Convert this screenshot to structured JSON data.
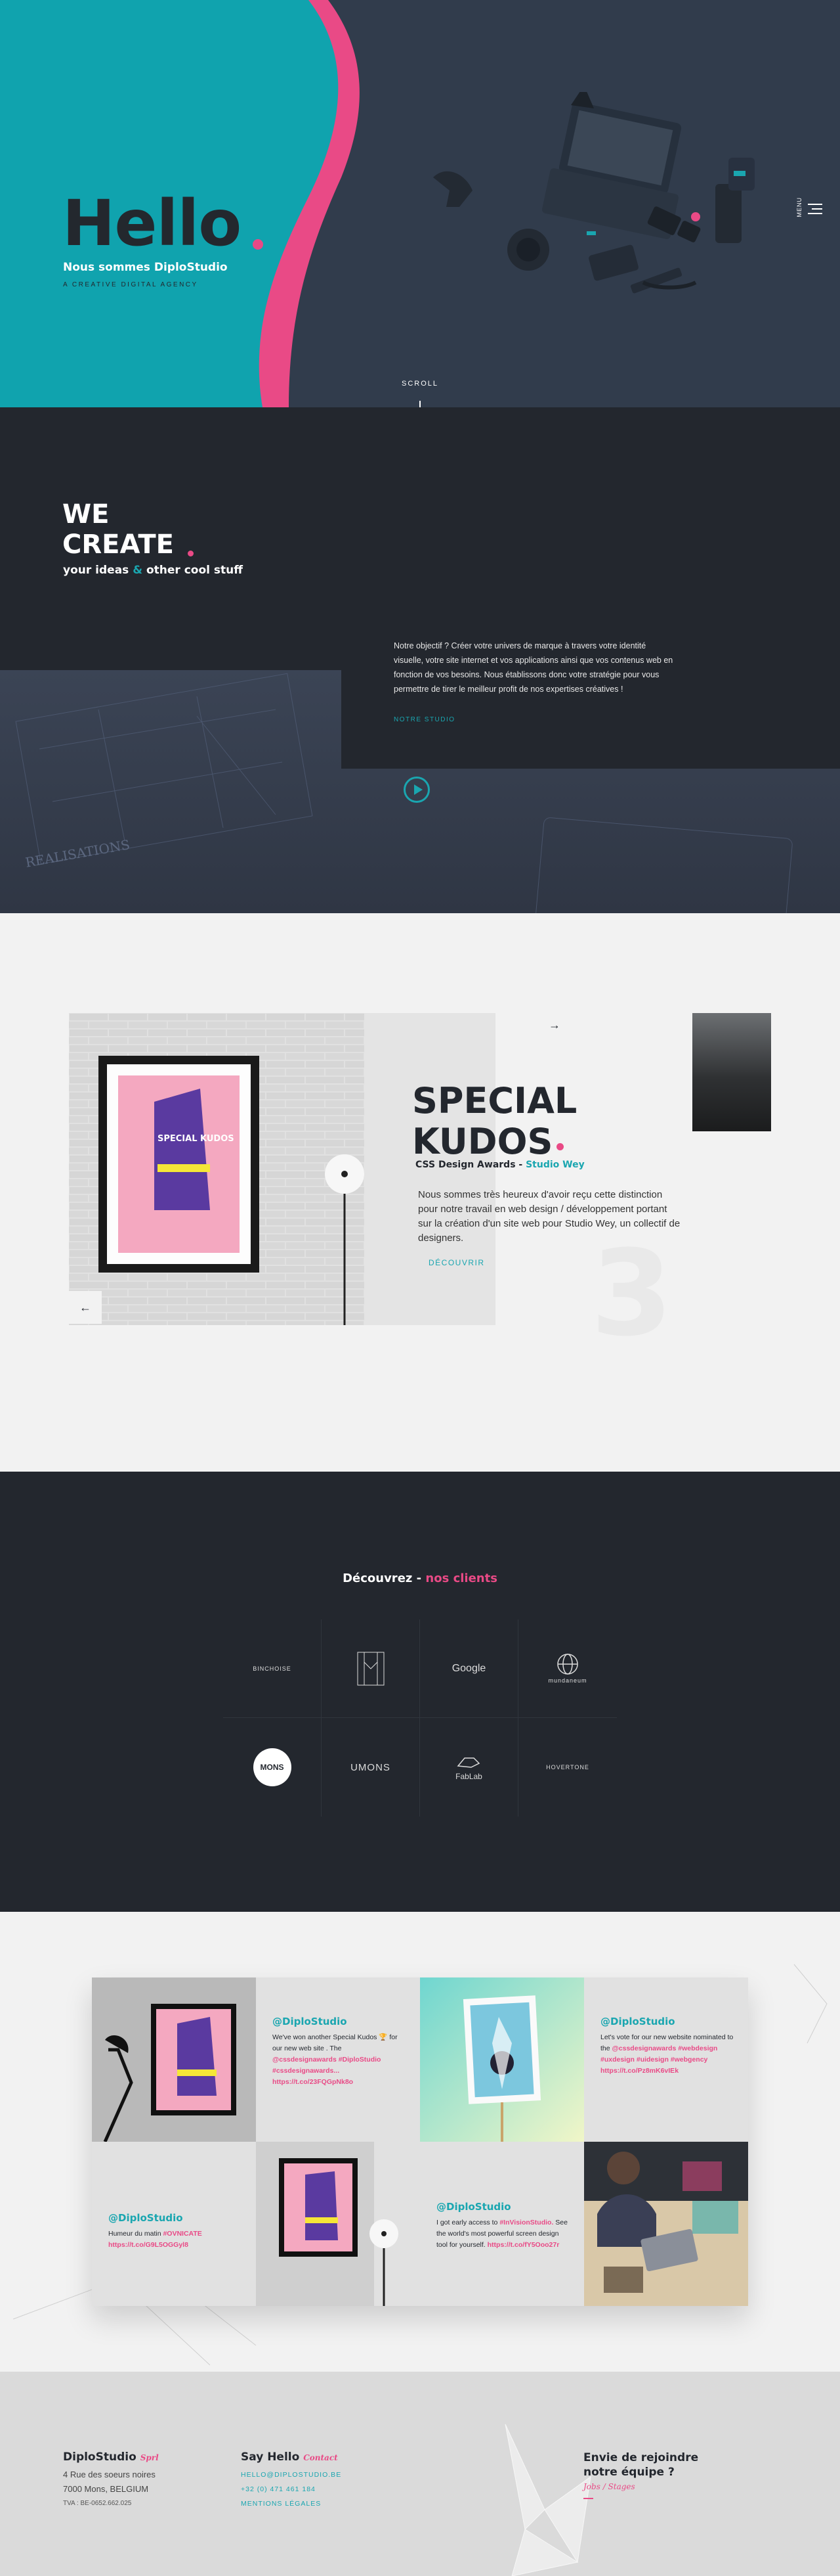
{
  "hero": {
    "title": "Hello",
    "subtitle": "Nous sommes DiploStudio",
    "tagline": "A CREATIVE DIGITAL AGENCY",
    "scroll_label": "SCROLL",
    "menu_label": "MENU"
  },
  "create": {
    "line1": "WE",
    "line2": "CREATE",
    "tagline_pre": "your ideas",
    "tagline_amp": "&",
    "tagline_post": "other cool stuff",
    "body": "Notre objectif ? Créer votre univers de marque à travers votre identité visuelle, votre site internet et vos applications ainsi que vos contenus web en fonction de vos besoins. Nous établissons donc votre stratégie pour vous permettre de tirer le meilleur profit de nos expertises créatives !",
    "link_label": "NOTRE STUDIO"
  },
  "kudos": {
    "title_line1": "SPECIAL",
    "title_line2": "KUDOS",
    "award_pre": "CSS Design Awards -",
    "award_client": "Studio Wey",
    "description": "Nous sommes très heureux d'avoir reçu cette distinction pour notre travail en web design / développement portant sur la création d'un site web pour Studio Wey, un collectif de designers.",
    "cta": "DÉCOUVRIR",
    "slide_number": "3",
    "next_arrow": "→",
    "prev_arrow": "←",
    "poster_text": "SPECIAL KUDOS"
  },
  "clients": {
    "heading_pre": "Découvrez -",
    "heading_hl": "nos clients",
    "logos": [
      "BINCHOISE",
      "film",
      "Google",
      "mundaneum",
      "MONS",
      "UMONS",
      "FabLab",
      "HOVERTONE"
    ]
  },
  "social": {
    "tiles": [
      {
        "handle": "@DiploStudio",
        "text": "We've won another Special Kudos 🏆 for our new web site . The",
        "tags": "@cssdesignawards #DiploStudio #cssdesignawards...",
        "link": "https://t.co/23FQGpNk8o"
      },
      {
        "handle": "@DiploStudio",
        "text": "Let's vote for our new website nominated to the",
        "tags": "@cssdesignawards #webdesign #uxdesign #uidesign #webgency",
        "link": "https://t.co/Pz8mK6vIEk"
      },
      {
        "handle": "@DiploStudio",
        "text": "Humeur du matin",
        "tags": "#OVNICATE",
        "link": "https://t.co/G9L5OGGyl8"
      },
      {
        "handle": "@DiploStudio",
        "text": "I got early access to",
        "tags": "#InVisionStudio.",
        "text2": "See the world's most powerful screen design tool for yourself.",
        "link": "https://t.co/fY5Ooo27r"
      }
    ]
  },
  "footer": {
    "brand": "DiploStudio",
    "brand_suffix": "Sprl",
    "address1": "4 Rue des soeurs noires",
    "address2": "7000 Mons, BELGIUM",
    "vat": "TVA : BE-0652.662.025",
    "contact_title": "Say Hello",
    "contact_suffix": "Contact",
    "email": "HELLO@DIPLOSTUDIO.BE",
    "phone": "+32 (0) 471 461 184",
    "legal": "MENTIONS LÉGALES",
    "jobs_title": "Envie de rejoindre notre équipe ?",
    "jobs_link": "Jobs / Stages"
  },
  "colors": {
    "teal": "#1aa6b0",
    "pink": "#e94a86",
    "dark": "#23272e",
    "light": "#f2f2f2"
  }
}
